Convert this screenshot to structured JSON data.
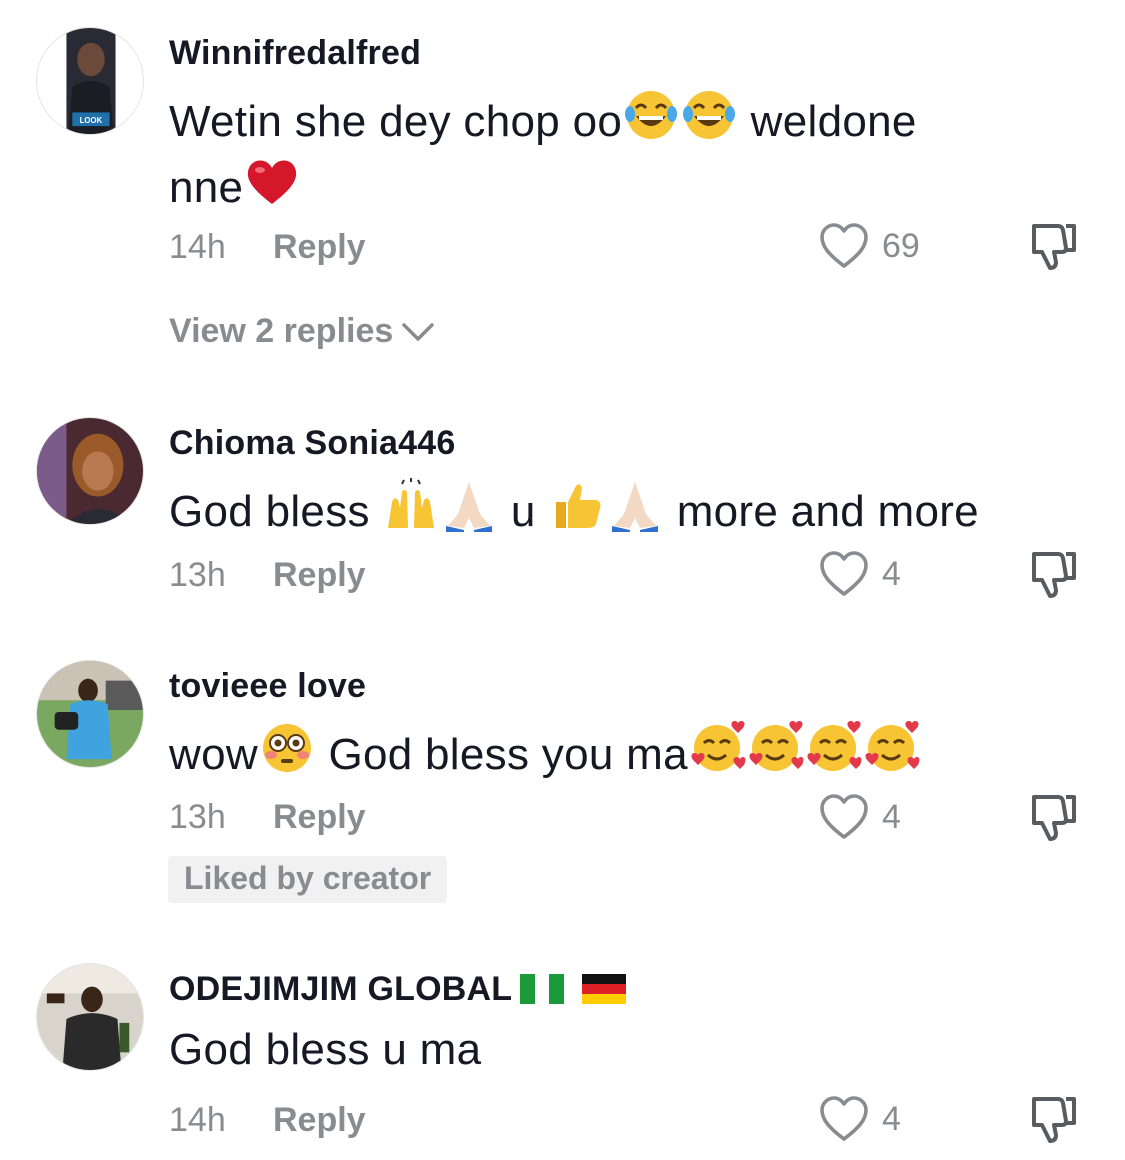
{
  "comments": [
    {
      "username": "Winnifredalfred",
      "text_a": "Wetin she dey chop oo",
      "text_b": " weldone",
      "text_c": "nne",
      "emojis": [
        "face-with-tears-of-joy-emoji",
        "face-with-tears-of-joy-emoji",
        "red-heart-emoji"
      ],
      "avatar_text": "LOOK",
      "time": "14h",
      "reply_label": "Reply",
      "likes": "69",
      "view_replies": "View 2 replies"
    },
    {
      "username": "Chioma Sonia446",
      "text_a": "God bless ",
      "text_b": " u ",
      "text_c": " more and more",
      "emojis": [
        "raising-hands-emoji",
        "folded-hands-emoji",
        "thumbs-up-emoji",
        "folded-hands-emoji"
      ],
      "time": "13h",
      "reply_label": "Reply",
      "likes": "4"
    },
    {
      "username": "tovieee love",
      "text_a": "wow",
      "text_b": " God bless you ma",
      "emojis": [
        "flushed-face-emoji",
        "smiling-face-with-hearts-emoji",
        "smiling-face-with-hearts-emoji",
        "smiling-face-with-hearts-emoji",
        "smiling-face-with-hearts-emoji"
      ],
      "time": "13h",
      "reply_label": "Reply",
      "likes": "4",
      "liked_by_creator": "Liked by creator"
    },
    {
      "username": "ODEJIMJIM GLOBAL",
      "flags": [
        "nigeria-flag-icon",
        "germany-flag-icon"
      ],
      "text_a": "God bless u ma",
      "time": "14h",
      "reply_label": "Reply",
      "likes": "4"
    }
  ],
  "colors": {
    "text": "#161823",
    "muted": "#8a8b91",
    "badge_bg": "#f1f1f2"
  }
}
